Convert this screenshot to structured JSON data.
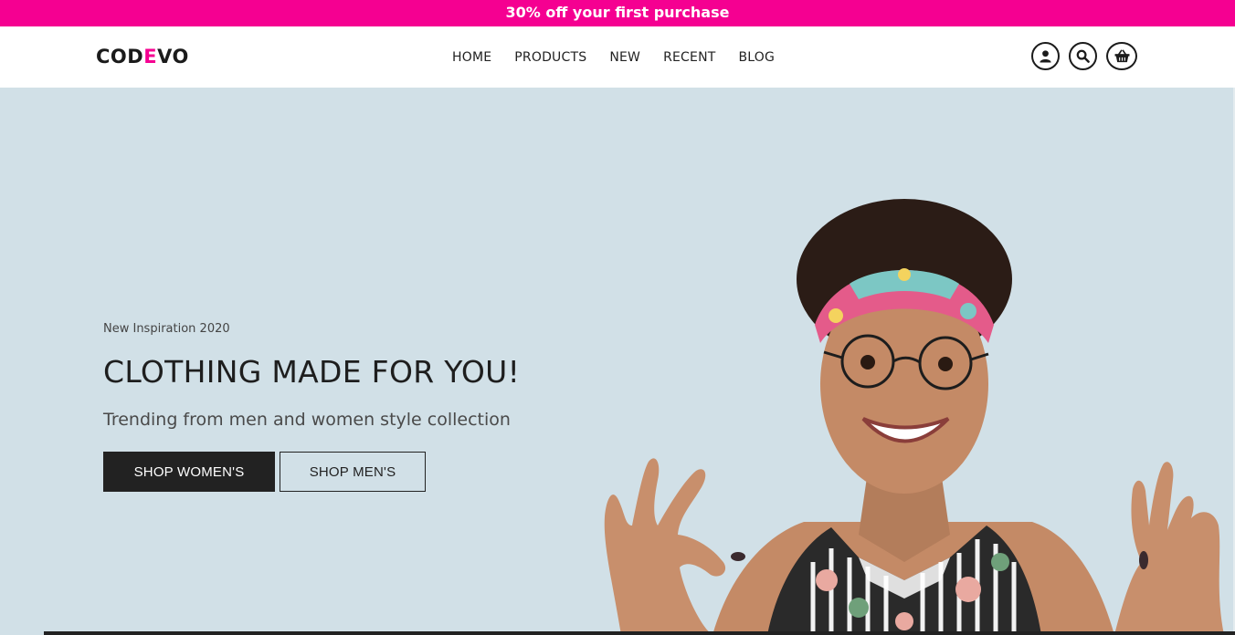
{
  "promo": {
    "text": "30% off your first purchase"
  },
  "brand": {
    "name_part1": "COD",
    "name_accent": "E",
    "name_part2": "VO",
    "accent_color": "#f50091"
  },
  "nav": {
    "items": [
      {
        "label": "HOME"
      },
      {
        "label": "PRODUCTS"
      },
      {
        "label": "NEW"
      },
      {
        "label": "RECENT"
      },
      {
        "label": "BLOG"
      }
    ],
    "icons": [
      "user-icon",
      "search-icon",
      "basket-icon"
    ]
  },
  "hero": {
    "kicker": "New Inspiration 2020",
    "headline": "CLOTHING MADE FOR YOU!",
    "subline": "Trending from men and women style collection",
    "primary_button": "SHOP WOMEN'S",
    "secondary_button": "SHOP MEN'S",
    "background_color": "#d1e0e7"
  }
}
